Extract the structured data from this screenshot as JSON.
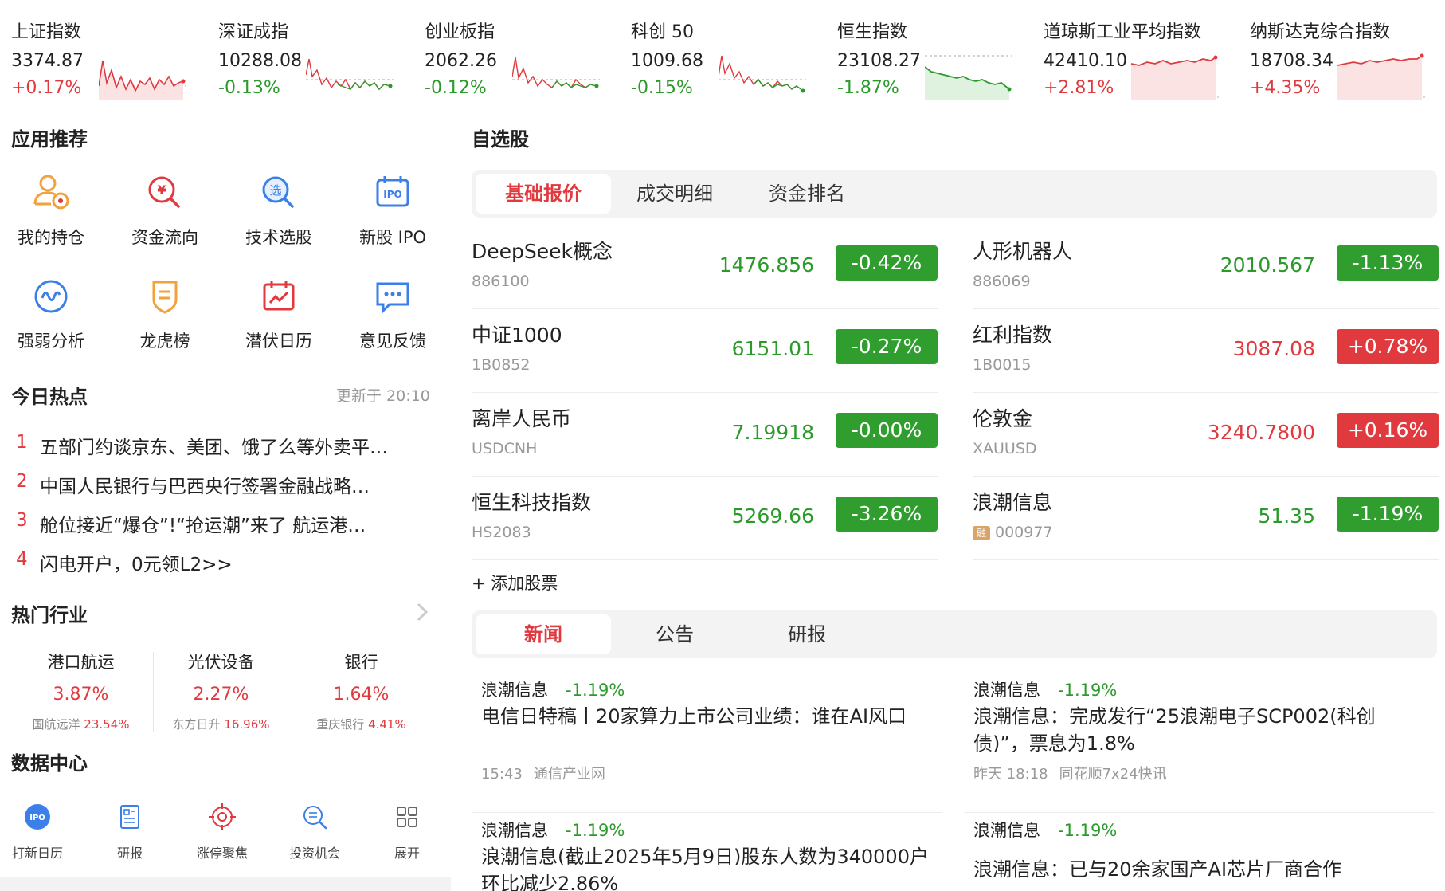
{
  "indices": [
    {
      "name": "上证指数",
      "value": "3374.87",
      "change": "+0.17%",
      "trend": "up"
    },
    {
      "name": "深证成指",
      "value": "10288.08",
      "change": "-0.13%",
      "trend": "down"
    },
    {
      "name": "创业板指",
      "value": "2062.26",
      "change": "-0.12%",
      "trend": "down"
    },
    {
      "name": "科创 50",
      "value": "1009.68",
      "change": "-0.15%",
      "trend": "down"
    },
    {
      "name": "恒生指数",
      "value": "23108.27",
      "change": "-1.87%",
      "trend": "down"
    },
    {
      "name": "道琼斯工业平均指数",
      "value": "42410.10",
      "change": "+2.81%",
      "trend": "up"
    },
    {
      "name": "纳斯达克综合指数",
      "value": "18708.34",
      "change": "+4.35%",
      "trend": "up"
    }
  ],
  "apps": {
    "title": "应用推荐",
    "items": [
      {
        "label": "我的持仓",
        "icon": "portfolio-user-icon"
      },
      {
        "label": "资金流向",
        "icon": "yuan-search-icon"
      },
      {
        "label": "技术选股",
        "icon": "stock-picker-icon"
      },
      {
        "label": "新股 IPO",
        "icon": "ipo-calendar-icon"
      },
      {
        "label": "强弱分析",
        "icon": "wave-analysis-icon"
      },
      {
        "label": "龙虎榜",
        "icon": "shield-badge-icon"
      },
      {
        "label": "潜伏日历",
        "icon": "calendar-chart-icon"
      },
      {
        "label": "意见反馈",
        "icon": "feedback-chat-icon"
      }
    ]
  },
  "hot": {
    "title": "今日热点",
    "updated": "更新于 20:10",
    "items": [
      {
        "num": "1",
        "text": "五部门约谈京东、美团、饿了么等外卖平…"
      },
      {
        "num": "2",
        "text": "中国人民银行与巴西央行签署金融战略…"
      },
      {
        "num": "3",
        "text": "舱位接近“爆仓”!“抢运潮”来了 航运港…"
      },
      {
        "num": "4",
        "text": "闪电开户，0元领L2>>"
      }
    ]
  },
  "industry": {
    "title": "热门行业",
    "items": [
      {
        "name": "港口航运",
        "pct": "3.87%",
        "lead_name": "国航远洋",
        "lead_pct": "23.54%"
      },
      {
        "name": "光伏设备",
        "pct": "2.27%",
        "lead_name": "东方日升",
        "lead_pct": "16.96%"
      },
      {
        "name": "银行",
        "pct": "1.64%",
        "lead_name": "重庆银行",
        "lead_pct": "4.41%"
      }
    ]
  },
  "data_center": {
    "title": "数据中心",
    "items": [
      {
        "label": "打新日历",
        "icon": "ipo-badge-icon"
      },
      {
        "label": "研报",
        "icon": "report-icon"
      },
      {
        "label": "涨停聚焦",
        "icon": "target-icon"
      },
      {
        "label": "投资机会",
        "icon": "search-opportunity-icon"
      },
      {
        "label": "展开",
        "icon": "grid-expand-icon"
      }
    ]
  },
  "watchlist": {
    "title": "自选股",
    "tabs": [
      "基础报价",
      "成交明细",
      "资金排名"
    ],
    "active_tab": 0,
    "stocks": [
      {
        "name": "DeepSeek概念",
        "code": "886100",
        "price": "1476.856",
        "change": "-0.42%",
        "trend": "down"
      },
      {
        "name": "人形机器人",
        "code": "886069",
        "price": "2010.567",
        "change": "-1.13%",
        "trend": "down"
      },
      {
        "name": "中证1000",
        "code": "1B0852",
        "price": "6151.01",
        "change": "-0.27%",
        "trend": "down"
      },
      {
        "name": "红利指数",
        "code": "1B0015",
        "price": "3087.08",
        "change": "+0.78%",
        "trend": "up"
      },
      {
        "name": "离岸人民币",
        "code": "USDCNH",
        "price": "7.19918",
        "change": "-0.00%",
        "trend": "down"
      },
      {
        "name": "伦敦金",
        "code": "XAUUSD",
        "price": "3240.7800",
        "change": "+0.16%",
        "trend": "up"
      },
      {
        "name": "恒生科技指数",
        "code": "HS2083",
        "price": "5269.66",
        "change": "-3.26%",
        "trend": "down"
      },
      {
        "name": "浪潮信息",
        "code": "000977",
        "badge": "融",
        "price": "51.35",
        "change": "-1.19%",
        "trend": "down"
      }
    ],
    "add_label": "+ 添加股票"
  },
  "news": {
    "tabs": [
      "新闻",
      "公告",
      "研报"
    ],
    "active_tab": 0,
    "items": [
      {
        "stock": "浪潮信息",
        "change": "-1.19%",
        "title": "电信日特稿丨20家算力上市公司业绩：谁在AI风口",
        "time": "15:43",
        "source": "通信产业网"
      },
      {
        "stock": "浪潮信息",
        "change": "-1.19%",
        "title": "浪潮信息：完成发行“25浪潮电子SCP002(科创债)”，票息为1.8%",
        "time": "昨天 18:18",
        "source": "同花顺7x24快讯"
      },
      {
        "stock": "浪潮信息",
        "change": "-1.19%",
        "title": "浪潮信息(截止2025年5月9日)股东人数为340000户 环比减少2.86%",
        "time": "",
        "source": ""
      },
      {
        "stock": "浪潮信息",
        "change": "-1.19%",
        "title": "浪潮信息：已与20余家国产AI芯片厂商合作",
        "time": "",
        "source": ""
      }
    ]
  },
  "colors": {
    "up": "#e0393e",
    "down": "#2b9a2b",
    "accent": "#e0393e"
  }
}
